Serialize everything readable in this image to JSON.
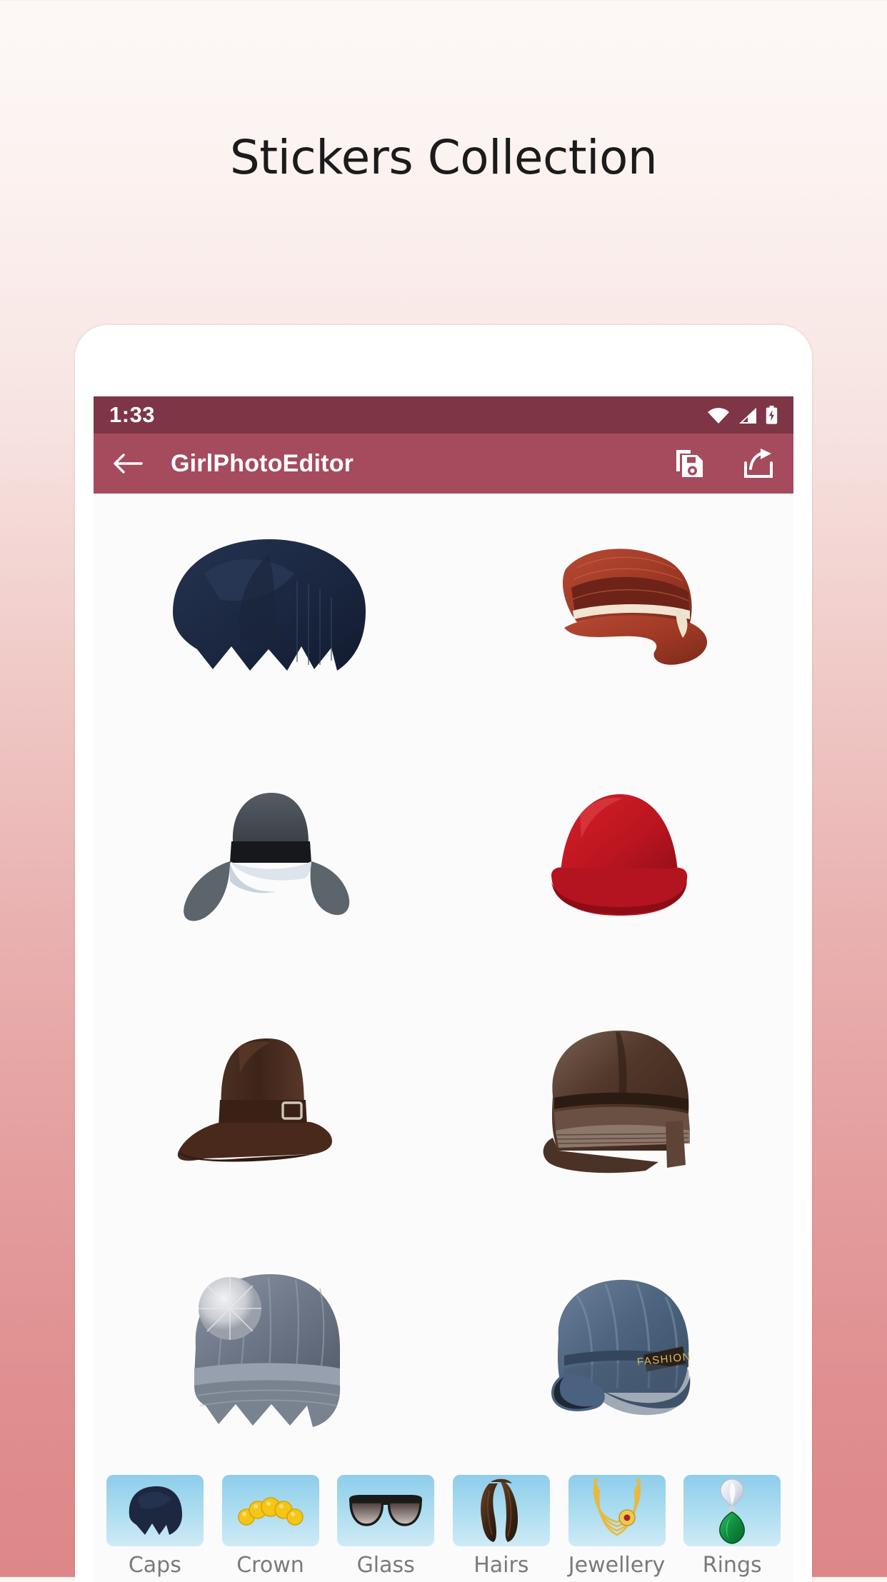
{
  "promo": {
    "title": "Stickers Collection"
  },
  "phone": {
    "statusbar": {
      "time": "1:33",
      "icons": [
        "wifi-icon",
        "signal-icon",
        "battery-charging-icon"
      ]
    },
    "appbar": {
      "back_icon": "back-arrow-icon",
      "title": "GirlPhotoEditor",
      "actions": [
        {
          "name": "save-icon",
          "label": "Save"
        },
        {
          "name": "share-icon",
          "label": "Share"
        }
      ]
    },
    "grid": {
      "items": [
        {
          "id": "sticker-1",
          "name": "navy-knit-beret",
          "alt": "Navy blue knit beret with bow"
        },
        {
          "id": "sticker-2",
          "name": "red-straw-fedora",
          "alt": "Red straw fedora with dark band"
        },
        {
          "id": "sticker-3",
          "name": "grey-floppy-hat",
          "alt": "Grey and black wide brim floppy hat"
        },
        {
          "id": "sticker-4",
          "name": "red-bowler-hat",
          "alt": "Red wool bowler hat"
        },
        {
          "id": "sticker-5",
          "name": "brown-buckle-hat",
          "alt": "Brown suede hat with buckle"
        },
        {
          "id": "sticker-6",
          "name": "brown-leather-cap",
          "alt": "Brown leather cap"
        },
        {
          "id": "sticker-7",
          "name": "grey-pompom-beanie",
          "alt": "Grey knit beanie with fur pom pom"
        },
        {
          "id": "sticker-8",
          "name": "blue-denim-cap",
          "alt": "Blue denim newsboy cap with Fashion tag"
        }
      ]
    },
    "categories": [
      {
        "label": "Caps",
        "icon": "cap-thumb-icon"
      },
      {
        "label": "Crown",
        "icon": "crown-thumb-icon"
      },
      {
        "label": "Glass",
        "icon": "glasses-thumb-icon"
      },
      {
        "label": "Hairs",
        "icon": "hair-thumb-icon"
      },
      {
        "label": "Jewellery",
        "icon": "necklace-thumb-icon"
      },
      {
        "label": "Rings",
        "icon": "pendant-thumb-icon"
      }
    ]
  },
  "colors": {
    "statusbar_bg": "#7e3545",
    "appbar_bg": "#a64a5e",
    "screen_bg": "#fbfbfb",
    "thumb_bg": "#8ecdeb",
    "label_text": "#7a7a7a",
    "page_bg_top": "#fdf8f6",
    "page_bg_bottom": "#dd8788"
  }
}
